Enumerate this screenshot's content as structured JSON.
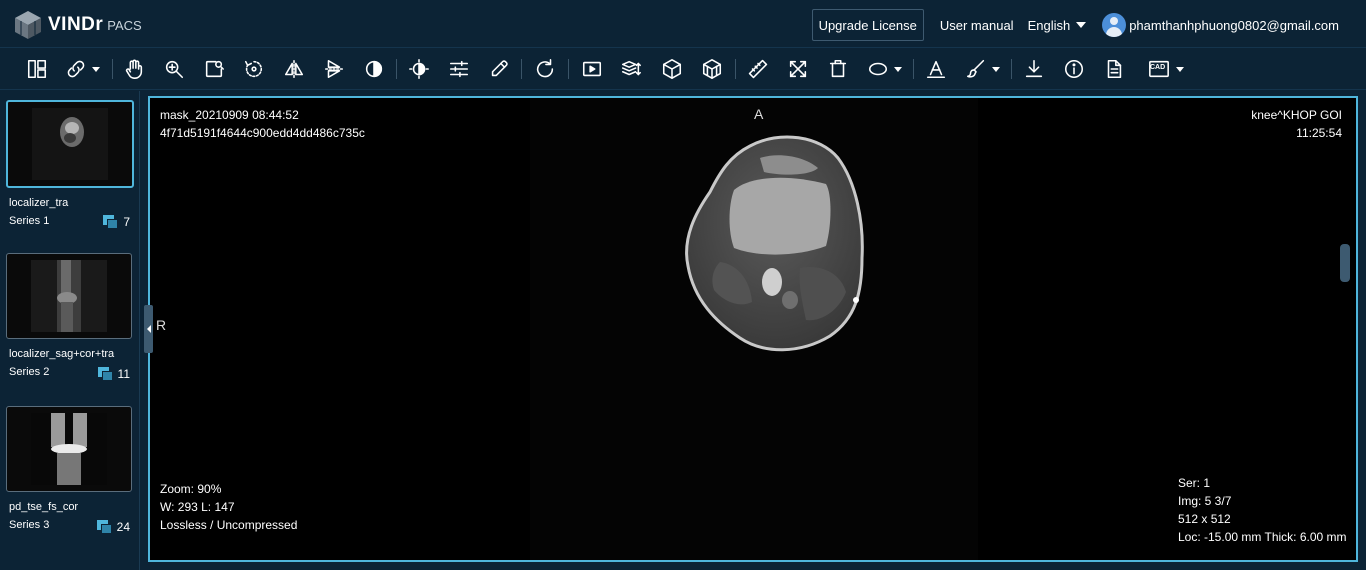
{
  "header": {
    "logo": {
      "brand": "VINDr",
      "product": "PACS"
    },
    "upgrade_label": "Upgrade License",
    "manual_label": "User manual",
    "language": "English",
    "user_email": "phamthanhphuong0802@gmail.com"
  },
  "toolbar": {
    "tools": [
      "layout-icon",
      "link-icon",
      "pan-icon",
      "zoom-icon",
      "magnify-region-icon",
      "rotate-icon",
      "flip-horizontal-icon",
      "flip-vertical-icon",
      "invert-icon",
      "window-level-icon",
      "adjust-icon",
      "eyedropper-icon",
      "reset-icon",
      "cine-play-icon",
      "stack-scroll-icon",
      "3d-icon",
      "mpr-icon",
      "ruler-icon",
      "crosshair-icon",
      "delete-icon",
      "ellipse-icon",
      "text-annotation-icon",
      "brush-icon",
      "download-icon",
      "info-icon",
      "report-icon",
      "cad-icon"
    ],
    "cad_label": "CAD"
  },
  "sidebar": {
    "series": [
      {
        "name": "localizer_tra",
        "number": "Series 1",
        "count": "7",
        "selected": true
      },
      {
        "name": "localizer_sag+cor+tra",
        "number": "Series 2",
        "count": "11",
        "selected": false
      },
      {
        "name": "pd_tse_fs_cor",
        "number": "Series 3",
        "count": "24",
        "selected": false
      }
    ]
  },
  "viewport": {
    "top_left": {
      "line1": "mask_20210909 08:44:52",
      "line2": "4f71d5191f4644c900edd4dd486c735c"
    },
    "top_right": {
      "line1": "knee^KHOP GOI",
      "line2": "11:25:54"
    },
    "bottom_left": {
      "zoom": "Zoom: 90%",
      "wl": "W: 293 L: 147",
      "compression": "Lossless / Uncompressed"
    },
    "bottom_right": {
      "series": "Ser: 1",
      "image": "Img: 5 3/7",
      "size": "512 x 512",
      "location": "Loc: -15.00 mm Thick: 6.00 mm"
    },
    "orientation_top": "A",
    "orientation_left": "R"
  },
  "colors": {
    "accent": "#4fb6dc",
    "background": "#0c2335"
  }
}
